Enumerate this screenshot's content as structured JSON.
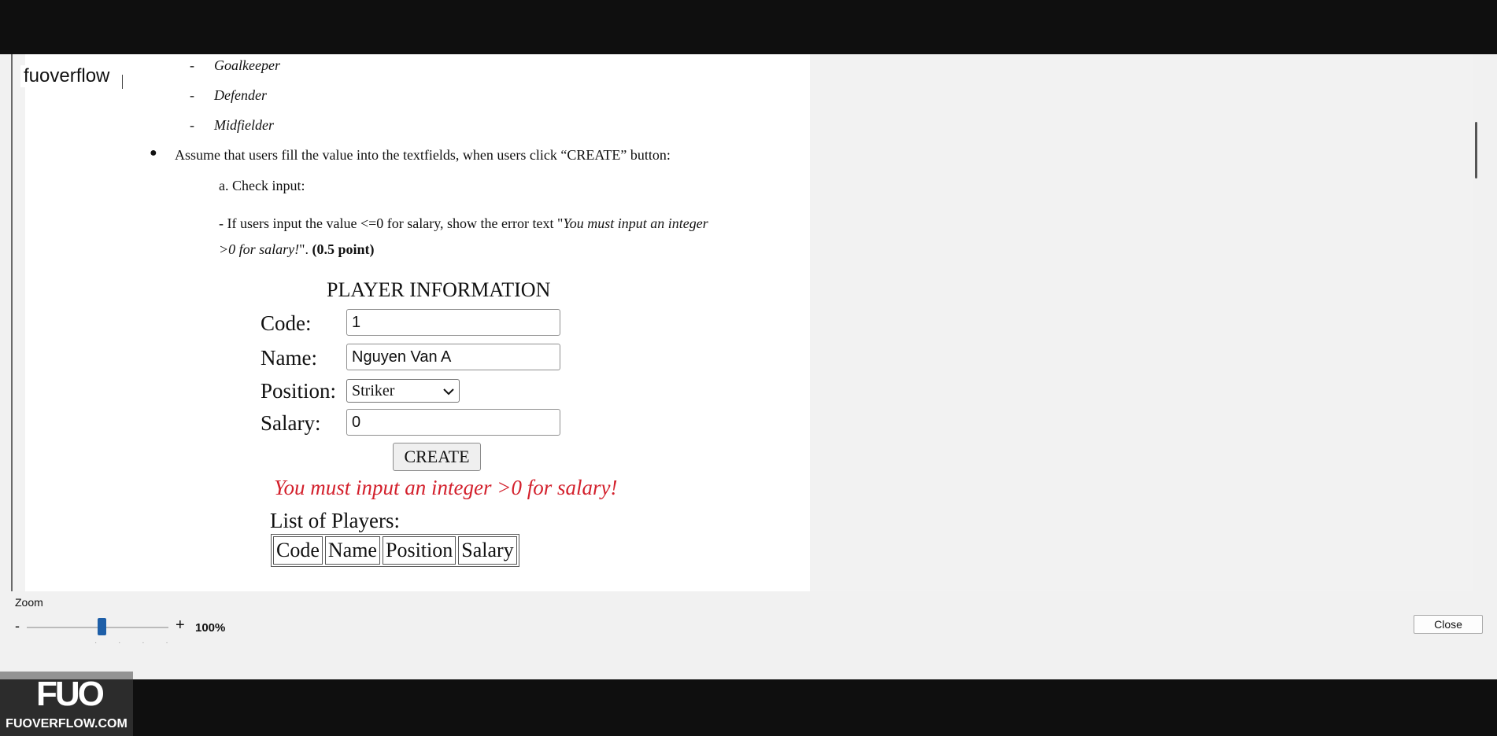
{
  "window": {
    "title": "fuoverflow"
  },
  "document": {
    "positions": [
      "Goalkeeper",
      "Defender",
      "Midfielder"
    ],
    "bullet": "Assume that users fill the value into the textfields, when users click “CREATE” button:",
    "check_input": "a. Check input:",
    "rule_text": "- If users input the value <=0 for salary, show the error text \"",
    "rule_italic": "You must input an integer",
    "rule_italic2": ">0 for salary!",
    "rule_end": "\". ",
    "rule_points": "(0.5 point)"
  },
  "form": {
    "title": "PLAYER INFORMATION",
    "code_label": "Code:",
    "code_value": "1",
    "name_label": "Name:",
    "name_value": "Nguyen Van A",
    "position_label": "Position:",
    "position_value": "Striker",
    "salary_label": "Salary:",
    "salary_value": "0",
    "create_label": "CREATE",
    "error": "You must input an integer >0 for salary!",
    "list_title": "List of Players:",
    "columns": [
      "Code",
      "Name",
      "Position",
      "Salary"
    ]
  },
  "controls": {
    "zoom_label": "Zoom",
    "zoom_minus": "-",
    "zoom_plus": "+",
    "zoom_value": "100%",
    "zoom_level_percent": 100,
    "close_label": "Close"
  },
  "watermark": {
    "brand": "FUOVERFLOW.COM",
    "logo": "FUO"
  }
}
